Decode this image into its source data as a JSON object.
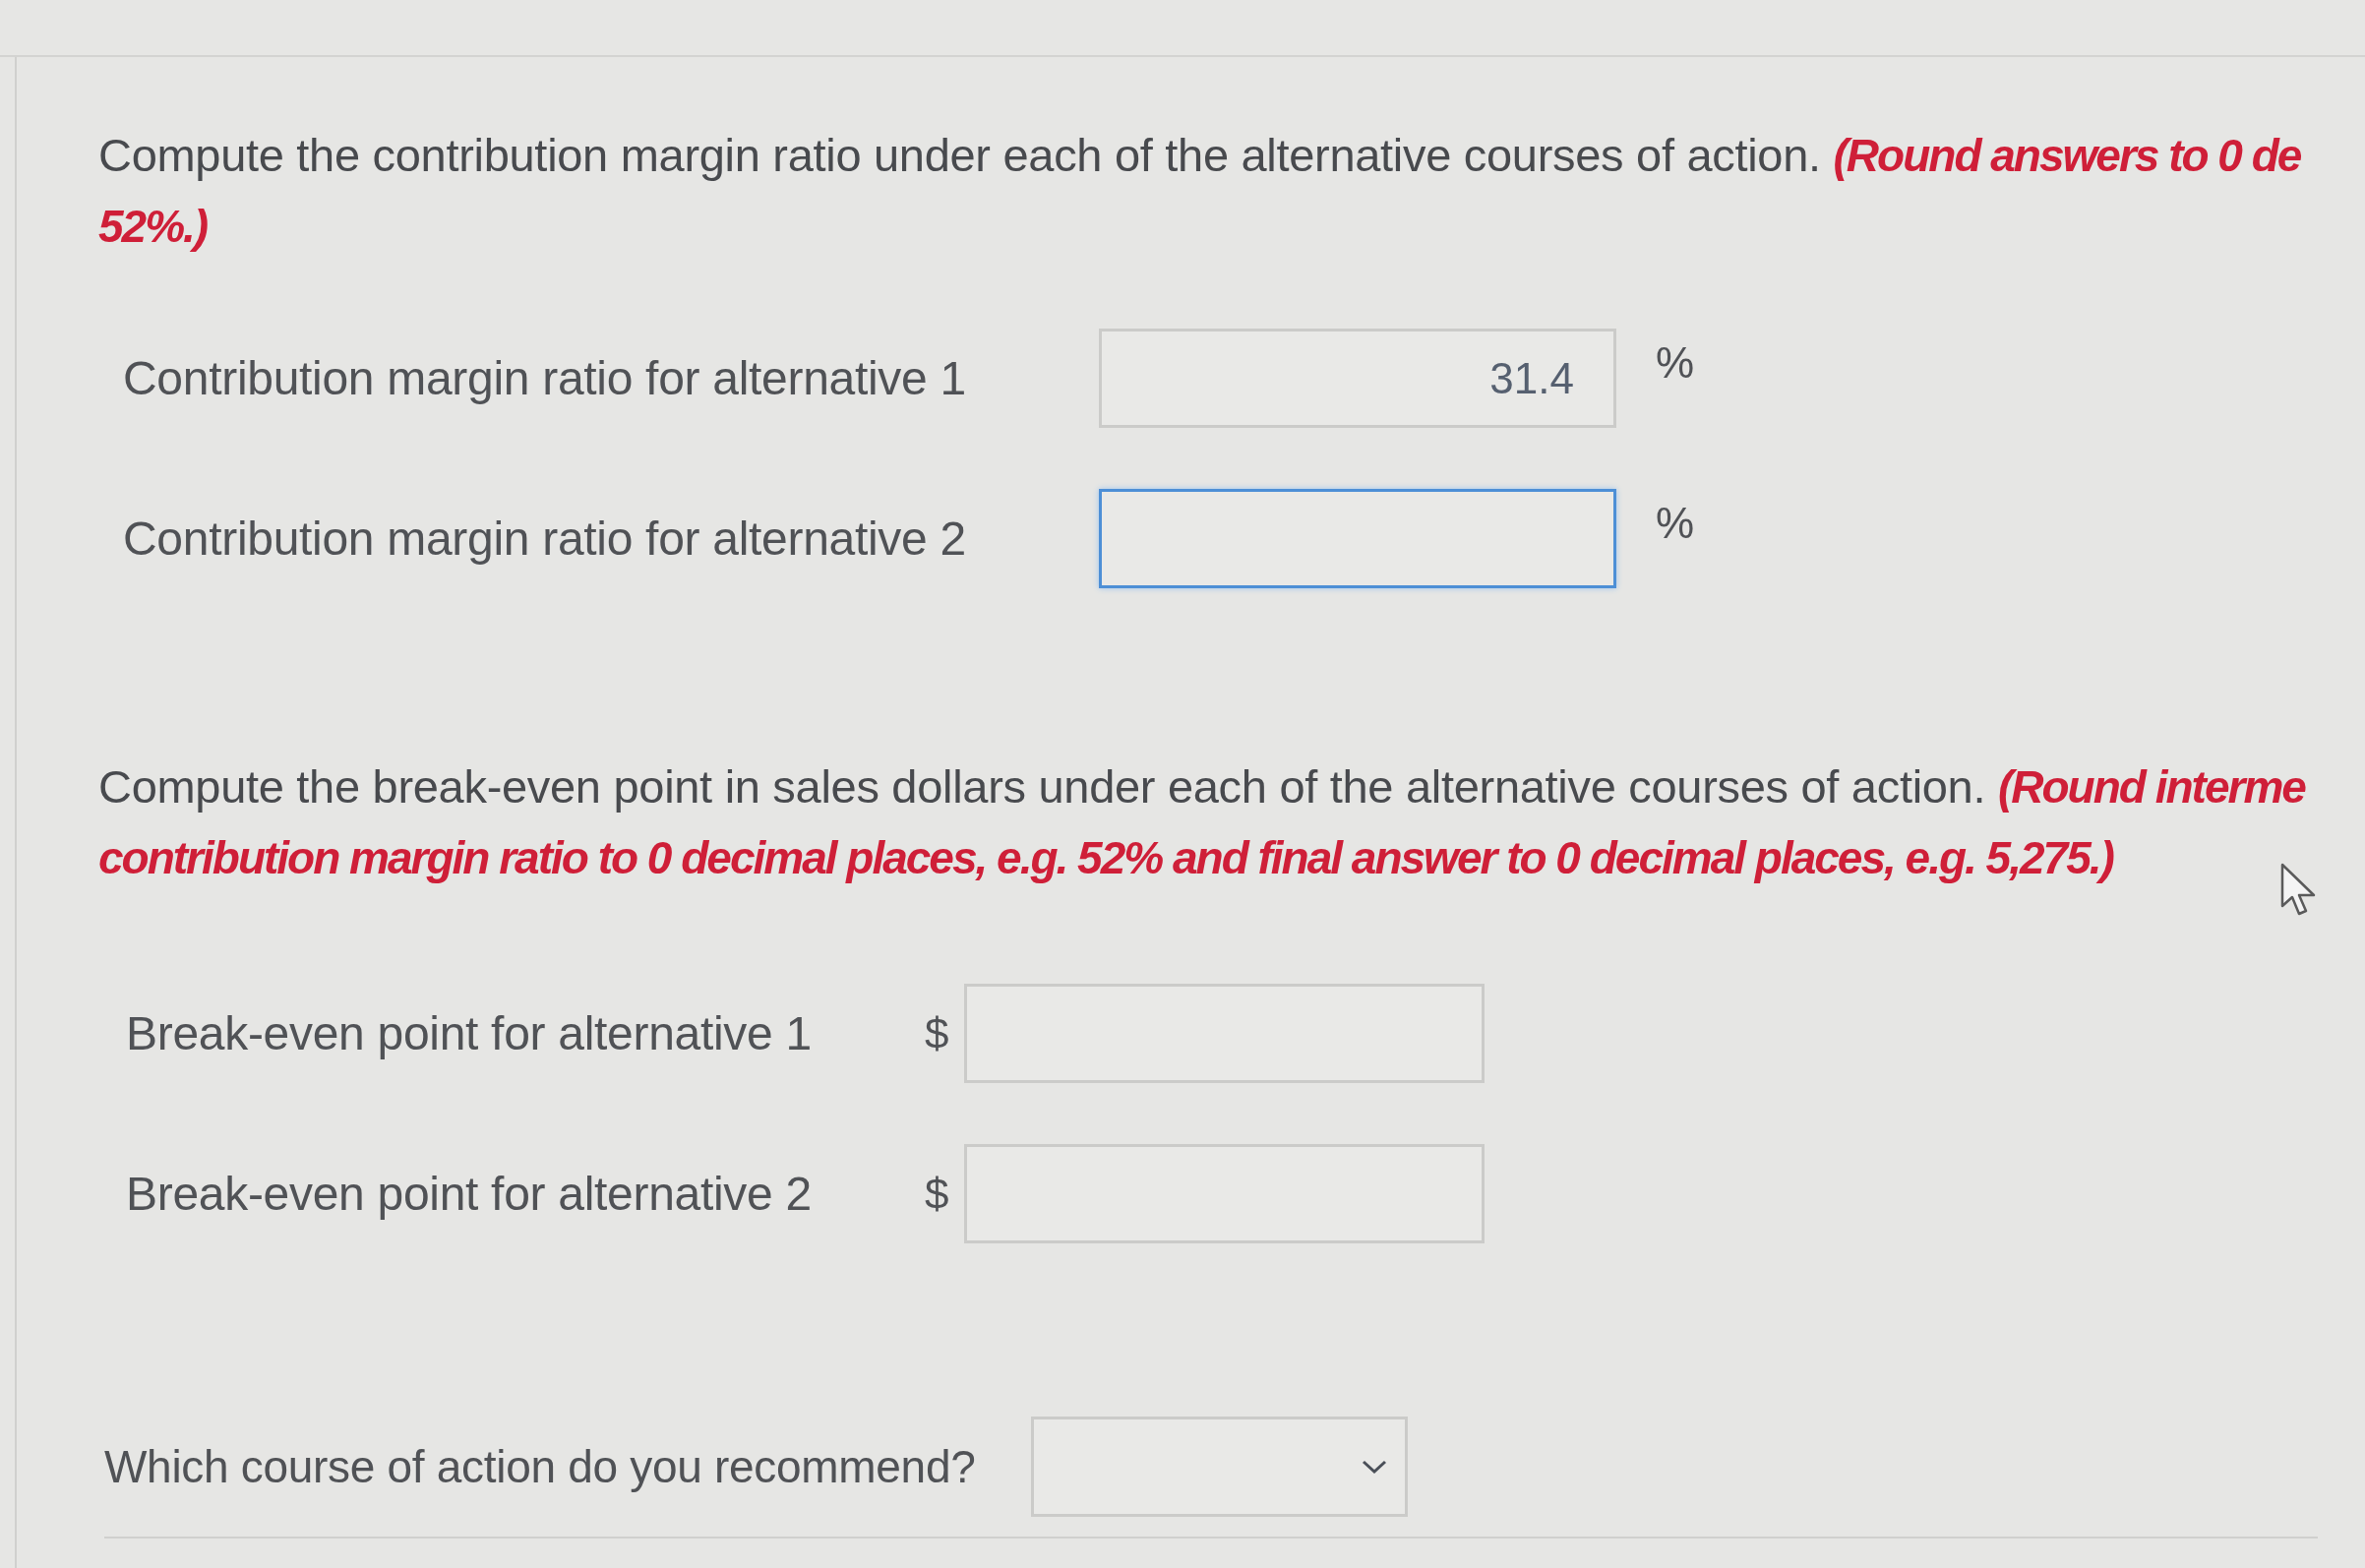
{
  "sections": [
    {
      "instruction": {
        "text": "Compute the contribution margin ratio under each of the alternative courses of action.",
        "note_lines": [
          "(Round answers to 0 de",
          "52%.)"
        ]
      },
      "rows": [
        {
          "label": "Contribution margin ratio for alternative 1",
          "suffix": "%",
          "value": "31.4",
          "focused": false
        },
        {
          "label": "Contribution margin ratio for alternative 2",
          "suffix": "%",
          "focused": true
        }
      ]
    },
    {
      "instruction": {
        "text": "Compute the break-even point in sales dollars under each of the alternative courses of action.",
        "note_lines": [
          "(Round interme",
          "contribution margin ratio to 0 decimal places, e.g. 52% and final answer to 0 decimal places, e.g. 5,275.)"
        ]
      },
      "rows": [
        {
          "label": "Break-even point for alternative 1",
          "prefix": "$",
          "focused": false
        },
        {
          "label": "Break-even point for alternative 2",
          "prefix": "$",
          "focused": false
        }
      ]
    }
  ],
  "question": {
    "label": "Which course of action do you recommend?"
  }
}
